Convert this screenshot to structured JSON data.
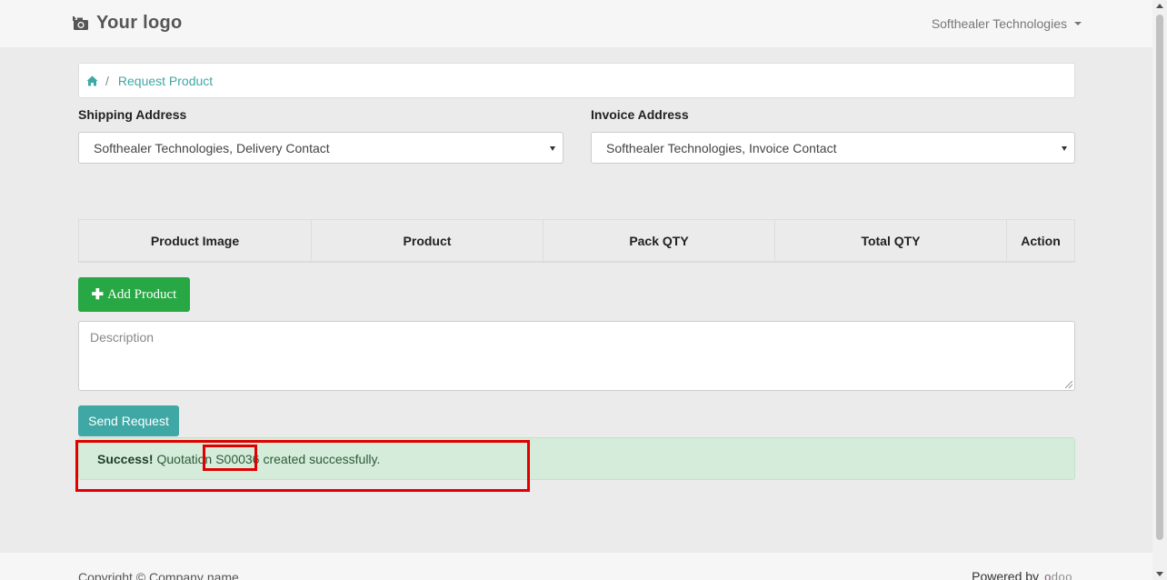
{
  "navbar": {
    "logo_text": "Your logo",
    "logo_icon": "camera-icon",
    "user_menu_label": "Softhealer Technologies"
  },
  "breadcrumb": {
    "home_icon": "home-icon",
    "separator": "/",
    "current": "Request Product"
  },
  "form": {
    "shipping_label": "Shipping Address",
    "shipping_value": "Softhealer Technologies, Delivery Contact",
    "invoice_label": "Invoice Address",
    "invoice_value": "Softhealer Technologies, Invoice Contact",
    "description_placeholder": "Description"
  },
  "table": {
    "columns": [
      "Product Image",
      "Product",
      "Pack QTY",
      "Total QTY",
      "Action"
    ]
  },
  "buttons": {
    "add_product": "Add Product",
    "add_icon": "plus-icon",
    "send_request": "Send Request"
  },
  "alert": {
    "strong": "Success!",
    "prefix": "Quotation",
    "quotation_number": "S00036",
    "suffix": "created successfully."
  },
  "footer": {
    "copyright": "Copyright © Company name",
    "powered_by": "Powered by",
    "brand_a": "o",
    "brand_b": "doo"
  },
  "colors": {
    "accent": "#3fa8a5",
    "success_button": "#28a745",
    "alert_bg": "#d4ecd9",
    "highlight": "#e00000"
  }
}
